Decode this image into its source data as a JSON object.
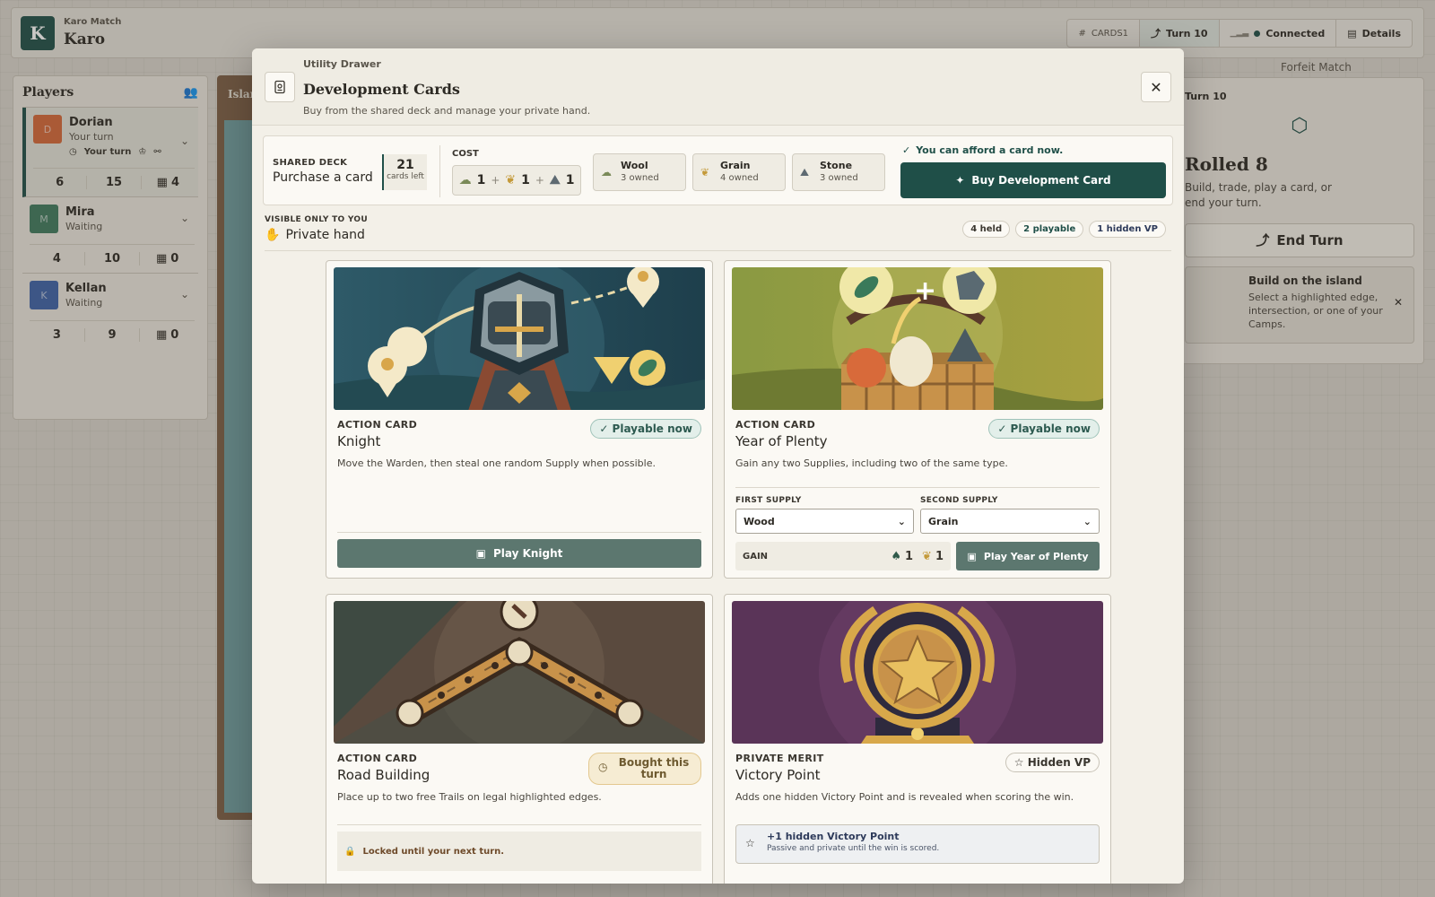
{
  "app": {
    "subtitle": "Karo Match",
    "title": "Karo",
    "logo_letter": "K"
  },
  "topbar": {
    "code": "CARDS1",
    "turn": "Turn 10",
    "connection": "Connected",
    "details": "Details",
    "forfeit": "Forfeit Match"
  },
  "players": {
    "title": "Players",
    "list": [
      {
        "name": "Dorian",
        "status": "Your turn",
        "badge": "Your turn",
        "initial": "D",
        "color": "#d5693a",
        "stats": [
          "6",
          "15",
          "4"
        ]
      },
      {
        "name": "Mira",
        "status": "Waiting",
        "initial": "M",
        "color": "#3f7a5f",
        "stats": [
          "4",
          "10",
          "0"
        ]
      },
      {
        "name": "Kellan",
        "status": "Waiting",
        "initial": "K",
        "color": "#3e63a8",
        "stats": [
          "3",
          "9",
          "0"
        ]
      }
    ]
  },
  "board": {
    "label": "Islan"
  },
  "turn_panel": {
    "turn_label": "Turn 10",
    "roll_title": "Rolled 8",
    "roll_desc": "Build, trade, play a card, or end your turn.",
    "end_turn": "End Turn",
    "hint_title": "Build on the island",
    "hint_desc": "Select a highlighted edge, intersection, or one of your Camps."
  },
  "modal": {
    "kicker": "Utility Drawer",
    "title": "Development Cards",
    "desc": "Buy from the shared deck and manage your private hand.",
    "deck": {
      "kicker": "SHARED DECK",
      "label": "Purchase a card",
      "count": "21",
      "count_label": "cards left"
    },
    "cost": {
      "label": "COST",
      "wool": "1",
      "grain": "1",
      "stone": "1"
    },
    "resources": [
      {
        "name": "Wool",
        "owned": "3 owned"
      },
      {
        "name": "Grain",
        "owned": "4 owned"
      },
      {
        "name": "Stone",
        "owned": "3 owned"
      }
    ],
    "afford": "You can afford a card now.",
    "buy": "Buy Development Card",
    "hand": {
      "kicker": "VISIBLE ONLY TO YOU",
      "label": "Private hand",
      "held": "4 held",
      "playable": "2 playable",
      "hidden_vp": "1 hidden VP"
    },
    "cards": {
      "knight": {
        "kind": "ACTION CARD",
        "name": "Knight",
        "badge": "Playable now",
        "desc": "Move the Warden, then steal one random Supply when possible.",
        "action": "Play Knight"
      },
      "yop": {
        "kind": "ACTION CARD",
        "name": "Year of Plenty",
        "badge": "Playable now",
        "desc": "Gain any two Supplies, including two of the same type.",
        "first_label": "FIRST SUPPLY",
        "first_value": "Wood",
        "second_label": "SECOND SUPPLY",
        "second_value": "Grain",
        "gain_label": "GAIN",
        "gain_a": "1",
        "gain_b": "1",
        "action": "Play Year of Plenty"
      },
      "road": {
        "kind": "ACTION CARD",
        "name": "Road Building",
        "badge": "Bought this turn",
        "desc": "Place up to two free Trails on legal highlighted edges.",
        "locked": "Locked until your next turn."
      },
      "vp": {
        "kind": "PRIVATE MERIT",
        "name": "Victory Point",
        "badge": "Hidden VP",
        "desc": "Adds one hidden Victory Point and is revealed when scoring the win.",
        "box_title": "+1 hidden Victory Point",
        "box_desc": "Passive and private until the win is scored."
      }
    }
  }
}
